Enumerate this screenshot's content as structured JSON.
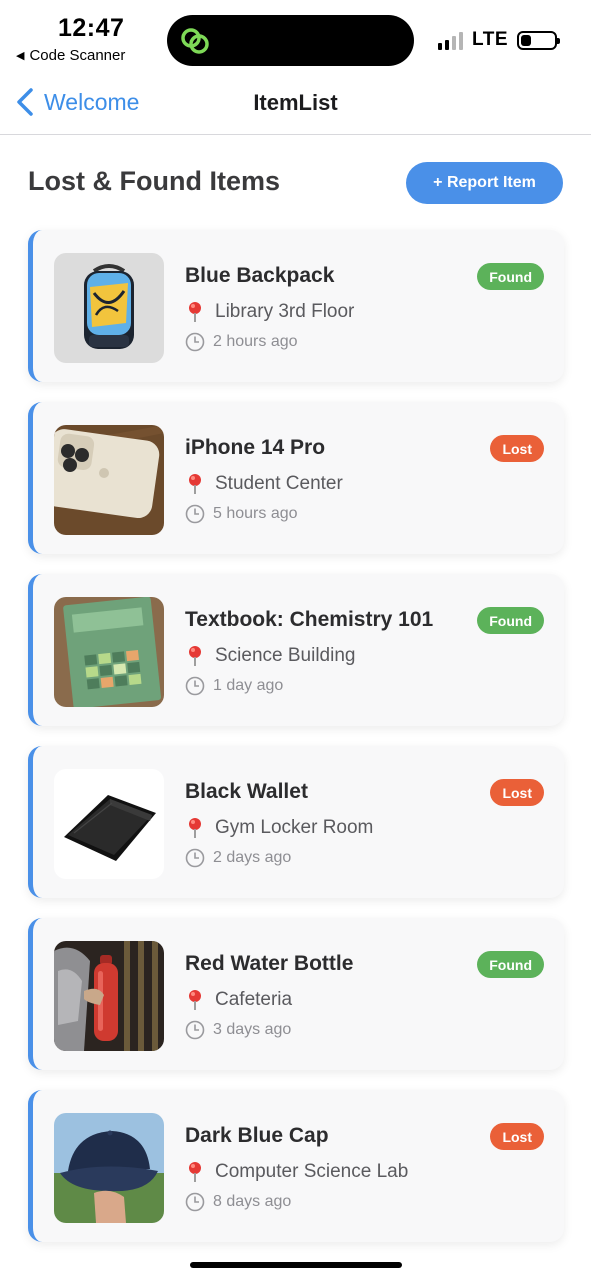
{
  "status_bar": {
    "time": "12:47",
    "back_app": "Code Scanner",
    "network": "LTE",
    "battery_level": 0.3
  },
  "nav": {
    "back_label": "Welcome",
    "title": "ItemList"
  },
  "header": {
    "title": "Lost & Found Items",
    "report_button_label": "+ Report Item"
  },
  "colors": {
    "accent": "#4a90e8",
    "found": "#5cb25a",
    "lost": "#ea6038"
  },
  "items": [
    {
      "name": "Blue Backpack",
      "status": "Found",
      "location": "Library 3rd Floor",
      "time": "2 hours ago",
      "image": "backpack-image"
    },
    {
      "name": "iPhone 14 Pro",
      "status": "Lost",
      "location": "Student Center",
      "time": "5 hours ago",
      "image": "phone-image"
    },
    {
      "name": "Textbook: Chemistry 101",
      "status": "Found",
      "location": "Science Building",
      "time": "1 day ago",
      "image": "textbook-image"
    },
    {
      "name": "Black Wallet",
      "status": "Lost",
      "location": "Gym Locker Room",
      "time": "2 days ago",
      "image": "wallet-image"
    },
    {
      "name": "Red Water Bottle",
      "status": "Found",
      "location": "Cafeteria",
      "time": "3 days ago",
      "image": "bottle-image"
    },
    {
      "name": "Dark Blue Cap",
      "status": "Lost",
      "location": "Computer Science Lab",
      "time": "8 days ago",
      "image": "cap-image"
    }
  ]
}
